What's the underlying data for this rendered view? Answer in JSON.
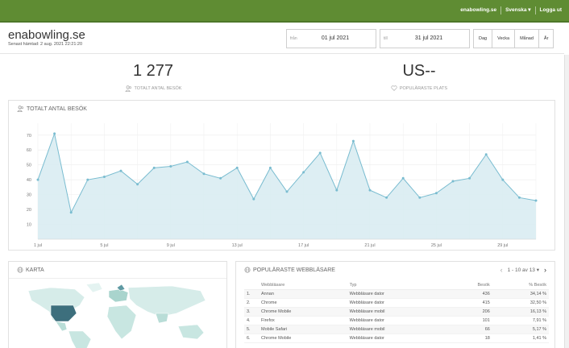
{
  "topbar": {
    "site": "enabowling.se",
    "language": "Svenska ▾",
    "logout": "Logga ut",
    "bar_color": "#5f8c33"
  },
  "header": {
    "title": "enabowling.se",
    "fetched": "Senast hämtad: 2 aug. 2021 22:21:20"
  },
  "date_range": {
    "from_label": "från",
    "from_value": "01 jul 2021",
    "to_label": "till",
    "to_value": "31 jul 2021"
  },
  "periods": [
    "Dag",
    "Vecka",
    "Månad",
    "År"
  ],
  "kpis": {
    "visits_value": "1 277",
    "visits_label": "TOTALT ANTAL BESÖK",
    "top_place_value": "US--",
    "top_place_label": "POPULÄRASTE PLATS"
  },
  "visits_panel": {
    "title": "TOTALT ANTAL BESÖK"
  },
  "chart_data": {
    "type": "area",
    "x_labels": [
      "1 jul",
      "5 jul",
      "9 jul",
      "13 jul",
      "17 jul",
      "21 jul",
      "25 jul",
      "29 jul"
    ],
    "x": [
      1,
      2,
      3,
      4,
      5,
      6,
      7,
      8,
      9,
      10,
      11,
      12,
      13,
      14,
      15,
      16,
      17,
      18,
      19,
      20,
      21,
      22,
      23,
      24,
      25,
      26,
      27,
      28,
      29,
      30,
      31
    ],
    "values": [
      40,
      71,
      18,
      40,
      42,
      46,
      37,
      48,
      49,
      52,
      44,
      41,
      48,
      27,
      48,
      32,
      45,
      58,
      33,
      66,
      33,
      28,
      41,
      28,
      31,
      39,
      41,
      57,
      40,
      28,
      26
    ],
    "yticks": [
      10,
      20,
      30,
      40,
      50,
      60,
      70
    ],
    "ylim": [
      0,
      78
    ],
    "grid": true,
    "line_color": "#79bcd0",
    "fill_color": "#d9ecf2"
  },
  "map_panel": {
    "title": "KARTA"
  },
  "browsers_panel": {
    "title": "POPULÄRASTE WEBBLÄSARE",
    "pager": "1 - 10 av 13 ▾",
    "prev": "‹",
    "next": "›",
    "columns": [
      "Webbläsare",
      "Typ",
      "Besök",
      "% Besök"
    ],
    "rows": [
      {
        "n": "1.",
        "name": "Annan",
        "type": "Webbläsare dator",
        "visits": "436",
        "pct": "34,14 %"
      },
      {
        "n": "2.",
        "name": "Chrome",
        "type": "Webbläsare dator",
        "visits": "415",
        "pct": "32,50 %"
      },
      {
        "n": "3.",
        "name": "Chrome Mobile",
        "type": "Webbläsare mobil",
        "visits": "206",
        "pct": "16,13 %"
      },
      {
        "n": "4.",
        "name": "Firefox",
        "type": "Webbläsare dator",
        "visits": "101",
        "pct": "7,91 %"
      },
      {
        "n": "5.",
        "name": "Mobile Safari",
        "type": "Webbläsare mobil",
        "visits": "66",
        "pct": "5,17 %"
      },
      {
        "n": "6.",
        "name": "Chrome Mobile",
        "type": "Webbläsare dator",
        "visits": "18",
        "pct": "1,41 %"
      }
    ]
  }
}
